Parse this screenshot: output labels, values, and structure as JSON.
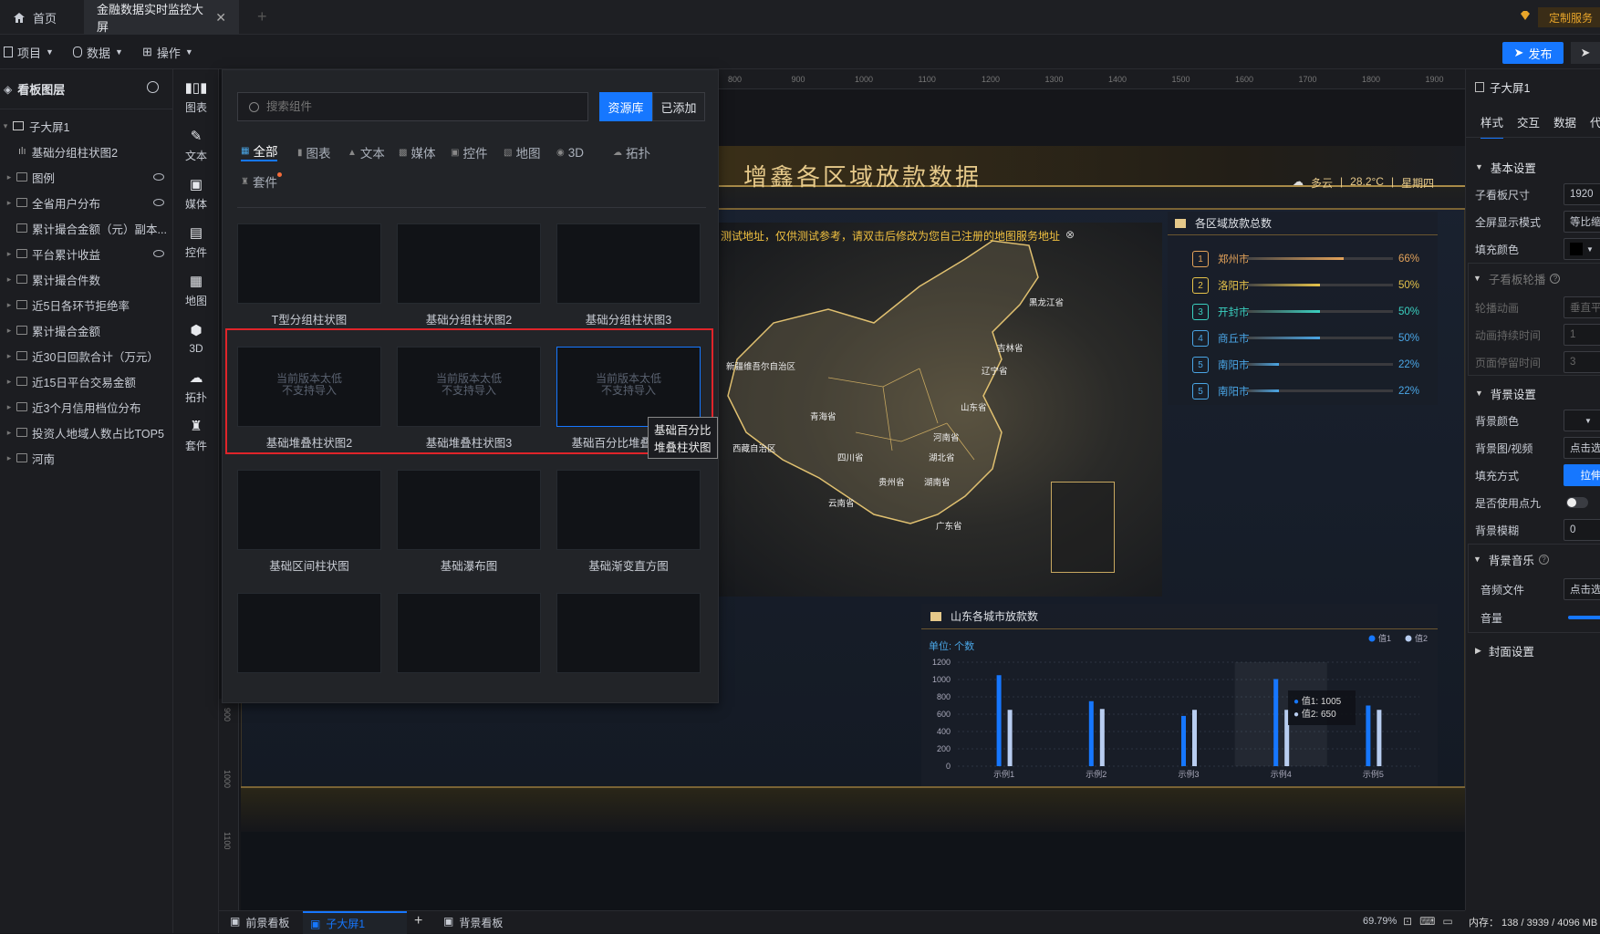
{
  "tabs": {
    "home": "首页",
    "active": "金融数据实时监控大屏",
    "plus": "+"
  },
  "topright": {
    "custom": "定制服务"
  },
  "menu": {
    "project": "项目",
    "data": "数据",
    "operate": "操作",
    "publish": "发布"
  },
  "layers": {
    "title": "看板图层",
    "items": [
      {
        "label": "子大屏1",
        "kind": "screen"
      },
      {
        "label": "基础分组柱状图2",
        "kind": "chart"
      },
      {
        "label": "图例",
        "kind": "group",
        "hidden": true
      },
      {
        "label": "全省用户分布",
        "kind": "group",
        "hidden": true
      },
      {
        "label": "累计撮合金额（元）副本...",
        "kind": "group"
      },
      {
        "label": "平台累计收益",
        "kind": "group",
        "hidden": true
      },
      {
        "label": "累计撮合件数",
        "kind": "group"
      },
      {
        "label": "近5日各环节拒绝率",
        "kind": "group"
      },
      {
        "label": "累计撮合金额",
        "kind": "group"
      },
      {
        "label": "近30日回款合计（万元）",
        "kind": "group"
      },
      {
        "label": "近15日平台交易金额",
        "kind": "group"
      },
      {
        "label": "近3个月信用档位分布",
        "kind": "group"
      },
      {
        "label": "投资人地域人数占比TOP5",
        "kind": "group"
      },
      {
        "label": "河南",
        "kind": "group"
      }
    ]
  },
  "rail": [
    {
      "label": "图表",
      "icon": "bar-chart-icon"
    },
    {
      "label": "文本",
      "icon": "text-icon"
    },
    {
      "label": "媒体",
      "icon": "media-icon"
    },
    {
      "label": "控件",
      "icon": "control-icon"
    },
    {
      "label": "地图",
      "icon": "map-icon"
    },
    {
      "label": "3D",
      "icon": "cube-icon"
    },
    {
      "label": "拓扑",
      "icon": "topology-icon"
    },
    {
      "label": "套件",
      "icon": "kit-icon"
    }
  ],
  "comp": {
    "search_placeholder": "搜索组件",
    "btn_repo": "资源库",
    "btn_added": "已添加",
    "cats": [
      "全部",
      "图表",
      "文本",
      "媒体",
      "控件",
      "地图",
      "3D",
      "拓扑",
      "套件"
    ],
    "unsupported": "当前版本太低\n不支持导入",
    "cards": [
      "T型分组柱状图",
      "基础分组柱状图2",
      "基础分组柱状图3",
      "基础堆叠柱状图2",
      "基础堆叠柱状图3",
      "基础百分比堆叠柱状图",
      "基础区间柱状图",
      "基础瀑布图",
      "基础渐变直方图",
      "",
      "",
      ""
    ],
    "tooltip": "基础百分比堆叠柱状图"
  },
  "ruler": [
    "800",
    "900",
    "1000",
    "1100",
    "1200",
    "1300",
    "1400",
    "1500",
    "1600",
    "1700",
    "1800",
    "1900"
  ],
  "ruler_v": [
    "900",
    "1000",
    "1100"
  ],
  "dash": {
    "title": "增鑫各区域放款数据",
    "weather": "多云",
    "temp": "28.2°C",
    "week": "星期四",
    "map_notice": "测试地址，仅供测试参考，请双击后修改为您自己注册的地图服务地址",
    "map_labels": [
      "黑龙江省",
      "吉林省",
      "新疆维吾尔自治区",
      "辽宁省",
      "青海省",
      "山东省",
      "河南省",
      "西藏自治区",
      "四川省",
      "湖北省",
      "贵州省",
      "湖南省",
      "云南省",
      "广东省"
    ],
    "rank_title": "各区域放款总数",
    "ranks": [
      {
        "n": "1",
        "city": "郑州市",
        "pct": "66%",
        "v": 0.66,
        "color": "#e2a25a"
      },
      {
        "n": "2",
        "city": "洛阳市",
        "pct": "50%",
        "v": 0.5,
        "color": "#e6c34a"
      },
      {
        "n": "3",
        "city": "开封市",
        "pct": "50%",
        "v": 0.5,
        "color": "#3ad0c0"
      },
      {
        "n": "4",
        "city": "商丘市",
        "pct": "50%",
        "v": 0.5,
        "color": "#4aa6e6"
      },
      {
        "n": "5",
        "city": "南阳市",
        "pct": "22%",
        "v": 0.22,
        "color": "#4aa6e6"
      },
      {
        "n": "5",
        "city": "南阳市",
        "pct": "22%",
        "v": 0.22,
        "color": "#4aa6e6"
      }
    ],
    "bar_title": "山东各城市放款数"
  },
  "chart_data": {
    "type": "bar",
    "title": "山东各城市放款数",
    "unit": "单位: 个数",
    "categories": [
      "示例1",
      "示例2",
      "示例3",
      "示例4",
      "示例5"
    ],
    "series": [
      {
        "name": "值1",
        "values": [
          1050,
          750,
          580,
          1005,
          700
        ],
        "color": "#1677ff"
      },
      {
        "name": "值2",
        "values": [
          650,
          660,
          650,
          650,
          650
        ],
        "color": "#b8cdf0"
      }
    ],
    "ylim": [
      0,
      1200
    ],
    "yticks": [
      "1200",
      "1000",
      "800",
      "600",
      "400",
      "200",
      "0"
    ],
    "legend": "top-right",
    "tooltip": {
      "v1": "值1:  1005",
      "v2": "值2:  650"
    }
  },
  "props": {
    "title": "子大屏1",
    "tabs": [
      "样式",
      "交互",
      "数据",
      "代"
    ],
    "sec_basic": "基本设置",
    "size_label": "子看板尺寸",
    "size_val": "1920",
    "fullscreen_label": "全屏显示模式",
    "fullscreen_val": "等比缩",
    "fill_label": "填充颜色",
    "carousel": "子看板轮播",
    "anim_label": "轮播动画",
    "anim_val": "垂直平",
    "dur_label": "动画持续时间",
    "dur_val": "1",
    "stay_label": "页面停留时间",
    "stay_val": "3",
    "sec_bg": "背景设置",
    "bgcolor_label": "背景颜色",
    "bgimg_label": "背景图/视频",
    "bgimg_val": "点击选",
    "fillmode_label": "填充方式",
    "fillmode_val": "拉伸",
    "nine_label": "是否使用点九",
    "blur_label": "背景模糊",
    "blur_val": "0",
    "music": "背景音乐",
    "audio_label": "音频文件",
    "audio_val": "点击选",
    "vol_label": "音量",
    "cover": "封面设置"
  },
  "bottom": {
    "t1": "前景看板",
    "t2": "子大屏1",
    "t3": "背景看板",
    "zoom": "69.79%",
    "mem": "内存： 138 / 3939 / 4096 MB"
  }
}
